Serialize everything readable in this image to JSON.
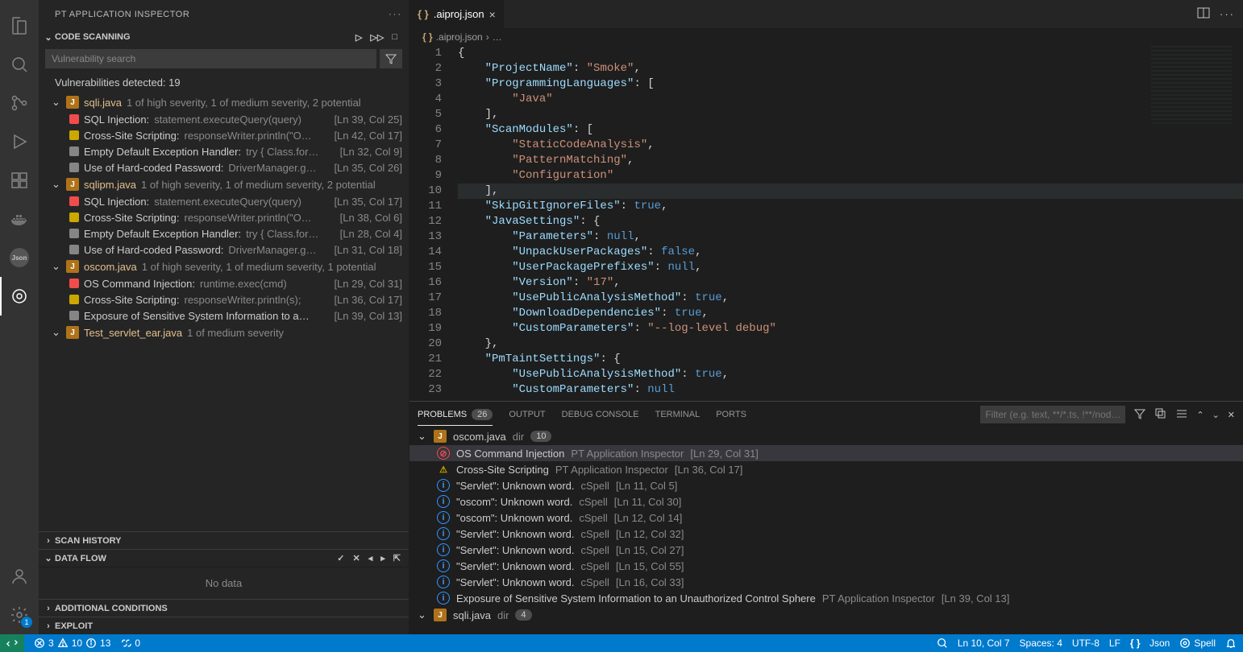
{
  "sidebar": {
    "extensionTitle": "PT APPLICATION INSPECTOR",
    "section1": "CODE SCANNING",
    "searchPlaceholder": "Vulnerability search",
    "detectedLabel": "Vulnerabilities detected: 19",
    "files": [
      {
        "name": "sqli.java",
        "meta": "1 of high severity, 1 of medium severity, 2 potential",
        "findings": [
          {
            "sev": "red",
            "title": "SQL Injection:",
            "detail": "statement.executeQuery(query)",
            "loc": "[Ln 39, Col 25]"
          },
          {
            "sev": "yellow",
            "title": "Cross-Site Scripting:",
            "detail": "responseWriter.println(\"O…",
            "loc": "[Ln 42, Col 17]"
          },
          {
            "sev": "gray",
            "title": "Empty Default Exception Handler:",
            "detail": "try { Class.for…",
            "loc": "[Ln 32, Col 9]"
          },
          {
            "sev": "gray",
            "title": "Use of Hard-coded Password:",
            "detail": "DriverManager.g…",
            "loc": "[Ln 35, Col 26]"
          }
        ]
      },
      {
        "name": "sqlipm.java",
        "meta": "1 of high severity, 1 of medium severity, 2 potential",
        "findings": [
          {
            "sev": "red",
            "title": "SQL Injection:",
            "detail": "statement.executeQuery(query)",
            "loc": "[Ln 35, Col 17]"
          },
          {
            "sev": "yellow",
            "title": "Cross-Site Scripting:",
            "detail": "responseWriter.println(\"O…",
            "loc": "[Ln 38, Col 6]"
          },
          {
            "sev": "gray",
            "title": "Empty Default Exception Handler:",
            "detail": "try { Class.for…",
            "loc": "[Ln 28, Col 4]"
          },
          {
            "sev": "gray",
            "title": "Use of Hard-coded Password:",
            "detail": "DriverManager.g…",
            "loc": "[Ln 31, Col 18]"
          }
        ]
      },
      {
        "name": "oscom.java",
        "meta": "1 of high severity, 1 of medium severity, 1 potential",
        "findings": [
          {
            "sev": "red",
            "title": "OS Command Injection:",
            "detail": "runtime.exec(cmd)",
            "loc": "[Ln 29, Col 31]"
          },
          {
            "sev": "yellow",
            "title": "Cross-Site Scripting:",
            "detail": "responseWriter.println(s);",
            "loc": "[Ln 36, Col 17]"
          },
          {
            "sev": "gray",
            "title": "Exposure of Sensitive System Information to a…",
            "detail": "",
            "loc": "[Ln 39, Col 13]"
          }
        ]
      },
      {
        "name": "Test_servlet_ear.java",
        "meta": "1 of medium severity",
        "findings": []
      }
    ],
    "scanHistory": "SCAN HISTORY",
    "dataFlow": "DATA FLOW",
    "noData": "No data",
    "additionalConditions": "ADDITIONAL CONDITIONS",
    "exploit": "EXPLOIT"
  },
  "editor": {
    "tabName": ".aiproj.json",
    "breadcrumb": ".aiproj.json",
    "breadcrumb2": "…",
    "lines": [
      "{",
      "    \"ProjectName\": \"Smoke\",",
      "    \"ProgrammingLanguages\": [",
      "        \"Java\"",
      "    ],",
      "    \"ScanModules\": [",
      "        \"StaticCodeAnalysis\",",
      "        \"PatternMatching\",",
      "        \"Configuration\"",
      "    ],",
      "    \"SkipGitIgnoreFiles\": true,",
      "    \"JavaSettings\": {",
      "        \"Parameters\": null,",
      "        \"UnpackUserPackages\": false,",
      "        \"UserPackagePrefixes\": null,",
      "        \"Version\": \"17\",",
      "        \"UsePublicAnalysisMethod\": true,",
      "        \"DownloadDependencies\": true,",
      "        \"CustomParameters\": \"--log-level debug\"",
      "    },",
      "    \"PmTaintSettings\": {",
      "        \"UsePublicAnalysisMethod\": true,",
      "        \"CustomParameters\": null"
    ],
    "highlightLine": 10
  },
  "panel": {
    "tabs": {
      "problems": "PROBLEMS",
      "problemsCount": "26",
      "output": "OUTPUT",
      "debug": "DEBUG CONSOLE",
      "terminal": "TERMINAL",
      "ports": "PORTS"
    },
    "filterPlaceholder": "Filter (e.g. text, **/*.ts, !**/nod…",
    "files": [
      {
        "name": "oscom.java",
        "dir": "dir",
        "count": "10",
        "items": [
          {
            "icon": "err",
            "msg": "OS Command Injection",
            "src": "PT Application Inspector",
            "loc": "[Ln 29, Col 31]",
            "selected": true
          },
          {
            "icon": "warn",
            "msg": "Cross-Site Scripting",
            "src": "PT Application Inspector",
            "loc": "[Ln 36, Col 17]"
          },
          {
            "icon": "info",
            "msg": "\"Servlet\": Unknown word.",
            "src": "cSpell",
            "loc": "[Ln 11, Col 5]"
          },
          {
            "icon": "info",
            "msg": "\"oscom\": Unknown word.",
            "src": "cSpell",
            "loc": "[Ln 11, Col 30]"
          },
          {
            "icon": "info",
            "msg": "\"oscom\": Unknown word.",
            "src": "cSpell",
            "loc": "[Ln 12, Col 14]"
          },
          {
            "icon": "info",
            "msg": "\"Servlet\": Unknown word.",
            "src": "cSpell",
            "loc": "[Ln 12, Col 32]"
          },
          {
            "icon": "info",
            "msg": "\"Servlet\": Unknown word.",
            "src": "cSpell",
            "loc": "[Ln 15, Col 27]"
          },
          {
            "icon": "info",
            "msg": "\"Servlet\": Unknown word.",
            "src": "cSpell",
            "loc": "[Ln 15, Col 55]"
          },
          {
            "icon": "info",
            "msg": "\"Servlet\": Unknown word.",
            "src": "cSpell",
            "loc": "[Ln 16, Col 33]"
          },
          {
            "icon": "info",
            "msg": "Exposure of Sensitive System Information to an Unauthorized Control Sphere",
            "src": "PT Application Inspector",
            "loc": "[Ln 39, Col 13]"
          }
        ]
      },
      {
        "name": "sqli.java",
        "dir": "dir",
        "count": "4",
        "items": []
      }
    ]
  },
  "status": {
    "errors": "3",
    "warnings": "10",
    "infos": "13",
    "ports": "0",
    "cursor": "Ln 10, Col 7",
    "spaces": "Spaces: 4",
    "encoding": "UTF-8",
    "eol": "LF",
    "lang": "Json",
    "spell": "Spell"
  }
}
